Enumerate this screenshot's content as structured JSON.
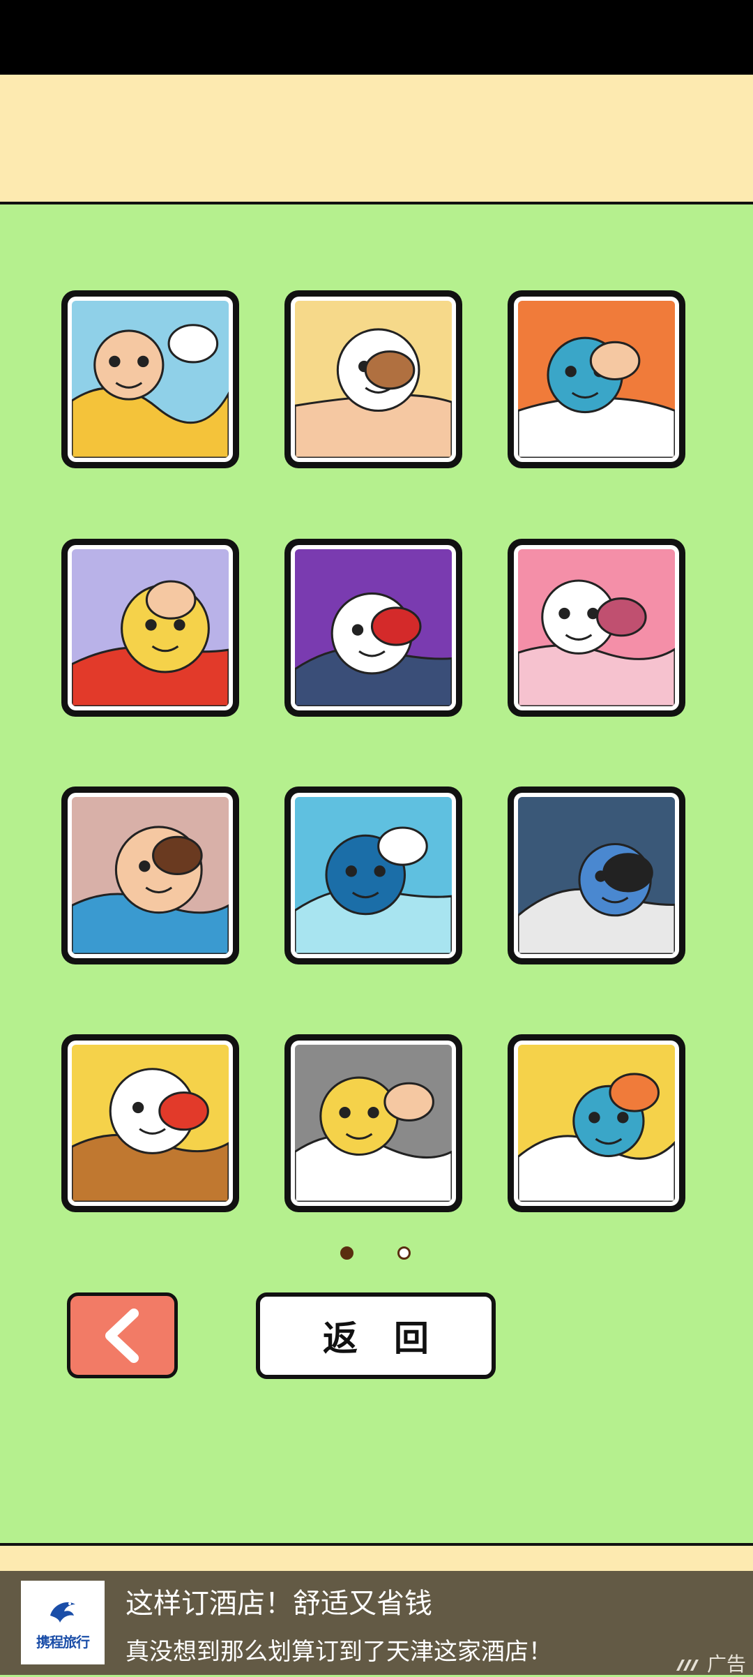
{
  "gallery": {
    "tiles": [
      {
        "label": "comic-panel-1",
        "palette": [
          "#8fd0e8",
          "#f4c33a",
          "#f5c8a2",
          "#ffffff"
        ]
      },
      {
        "label": "comic-panel-2",
        "palette": [
          "#f6d98a",
          "#f5c8a2",
          "#ffffff",
          "#b07040"
        ]
      },
      {
        "label": "comic-panel-3",
        "palette": [
          "#f07b3a",
          "#ffffff",
          "#3aa6c8",
          "#f5c8a2"
        ]
      },
      {
        "label": "comic-panel-4",
        "palette": [
          "#b9b2e8",
          "#e23a2a",
          "#f5d24a",
          "#f5c8a2"
        ]
      },
      {
        "label": "comic-panel-5",
        "palette": [
          "#7a3bb0",
          "#3a4e78",
          "#ffffff",
          "#d42a2a"
        ]
      },
      {
        "label": "comic-panel-6",
        "palette": [
          "#f48fa8",
          "#f6c2cf",
          "#ffffff",
          "#c05070"
        ]
      },
      {
        "label": "comic-panel-7",
        "palette": [
          "#d8b0a8",
          "#3a9ad0",
          "#f5c8a2",
          "#6a3a20"
        ]
      },
      {
        "label": "comic-panel-8",
        "palette": [
          "#5fc0e0",
          "#a8e4f0",
          "#1b6ea8",
          "#ffffff"
        ]
      },
      {
        "label": "comic-panel-9",
        "palette": [
          "#3a5878",
          "#e8e8e8",
          "#4a88d0",
          "#222222"
        ]
      },
      {
        "label": "comic-panel-10",
        "palette": [
          "#f5d24a",
          "#c07830",
          "#ffffff",
          "#e23a2a"
        ]
      },
      {
        "label": "comic-panel-11",
        "palette": [
          "#8a8a8a",
          "#ffffff",
          "#f5d24a",
          "#f5c8a2"
        ]
      },
      {
        "label": "comic-panel-12",
        "palette": [
          "#f5d24a",
          "#ffffff",
          "#3aa6c8",
          "#f07b3a"
        ]
      }
    ]
  },
  "pager": {
    "current_page": 1,
    "total_pages": 2
  },
  "controls": {
    "back_label": "返回"
  },
  "ad": {
    "brand": "携程旅行",
    "title": "这样订酒店！舒适又省钱",
    "description": "真没想到那么划算订到了天津这家酒店！",
    "label": "广告"
  },
  "colors": {
    "background": "#b5f08e",
    "band": "#fdeab0",
    "prev_button": "#f27b66",
    "ad_background": "#635a45"
  }
}
